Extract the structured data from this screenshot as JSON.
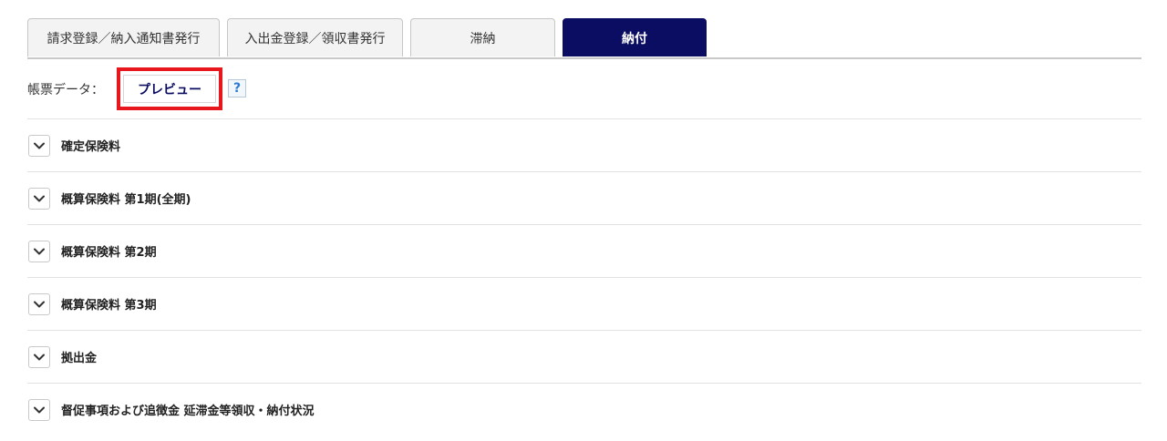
{
  "tabs": [
    {
      "label": "請求登録／納入通知書発行",
      "active": false
    },
    {
      "label": "入出金登録／領収書発行",
      "active": false
    },
    {
      "label": "滞納",
      "active": false
    },
    {
      "label": "納付",
      "active": true
    }
  ],
  "form": {
    "label": "帳票データ：",
    "preview_label": "プレビュー",
    "help_label": "?"
  },
  "sections": [
    {
      "title": "確定保険料"
    },
    {
      "title": "概算保険料 第1期(全期)"
    },
    {
      "title": "概算保険料 第2期"
    },
    {
      "title": "概算保険料 第3期"
    },
    {
      "title": "拠出金"
    },
    {
      "title": "督促事項および追徴金 延滞金等領収・納付状況"
    }
  ],
  "colors": {
    "active_tab": "#0b0d63",
    "highlight": "#e8171d",
    "help": "#2b7bd6"
  },
  "icons": {
    "section_toggle": "chevron-down-icon",
    "help": "question-icon"
  }
}
